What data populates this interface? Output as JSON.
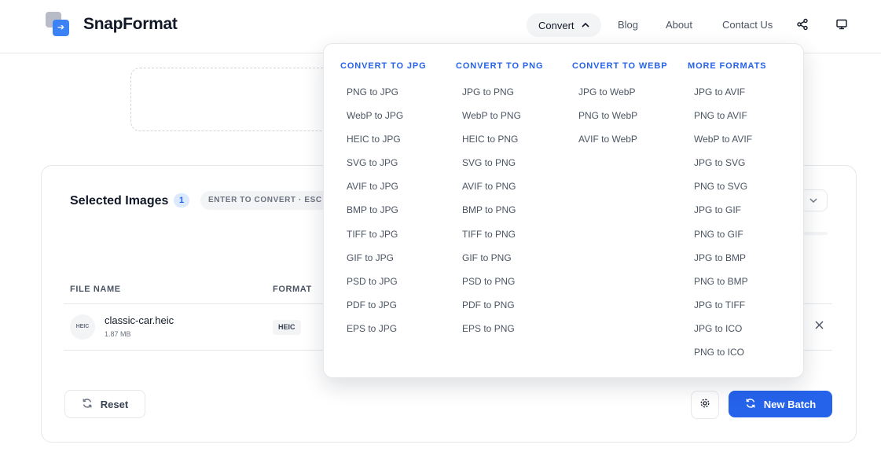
{
  "brand": {
    "name": "SnapFormat"
  },
  "nav": {
    "convert_label": "Convert",
    "blog_label": "Blog",
    "about_label": "About",
    "contact_label": "Contact Us"
  },
  "card": {
    "title": "Selected Images",
    "count": "1",
    "hint": "ENTER TO CONVERT · ESC T"
  },
  "table": {
    "headers": {
      "name": "FILE NAME",
      "format": "FORMAT"
    },
    "rows": [
      {
        "thumb": "HEIC",
        "name": "classic-car.heic",
        "size": "1.87 MB",
        "format": "HEIC"
      }
    ]
  },
  "actions": {
    "reset_label": "Reset",
    "new_batch_label": "New Batch"
  },
  "menu": {
    "columns": [
      {
        "heading": "CONVERT TO JPG",
        "items": [
          "PNG to JPG",
          "WebP to JPG",
          "HEIC to JPG",
          "SVG to JPG",
          "AVIF to JPG",
          "BMP to JPG",
          "TIFF to JPG",
          "GIF to JPG",
          "PSD to JPG",
          "PDF to JPG",
          "EPS to JPG"
        ]
      },
      {
        "heading": "CONVERT TO PNG",
        "items": [
          "JPG to PNG",
          "WebP to PNG",
          "HEIC to PNG",
          "SVG to PNG",
          "AVIF to PNG",
          "BMP to PNG",
          "TIFF to PNG",
          "GIF to PNG",
          "PSD to PNG",
          "PDF to PNG",
          "EPS to PNG"
        ]
      },
      {
        "heading": "CONVERT TO WEBP",
        "items": [
          "JPG to WebP",
          "PNG to WebP",
          "AVIF to WebP"
        ]
      },
      {
        "heading": "MORE FORMATS",
        "items": [
          "JPG to AVIF",
          "PNG to AVIF",
          "WebP to AVIF",
          "JPG to SVG",
          "PNG to SVG",
          "JPG to GIF",
          "PNG to GIF",
          "JPG to BMP",
          "PNG to BMP",
          "JPG to TIFF",
          "JPG to ICO",
          "PNG to ICO"
        ]
      }
    ]
  },
  "colors": {
    "accent": "#2563eb",
    "logo_front": "#3b82f6",
    "logo_back": "#b8bcc6"
  },
  "icons": [
    "logo-icon",
    "chevron-up-icon",
    "share-icon",
    "monitor-icon",
    "chevron-down-icon",
    "close-icon",
    "refresh-icon",
    "gear-icon"
  ]
}
